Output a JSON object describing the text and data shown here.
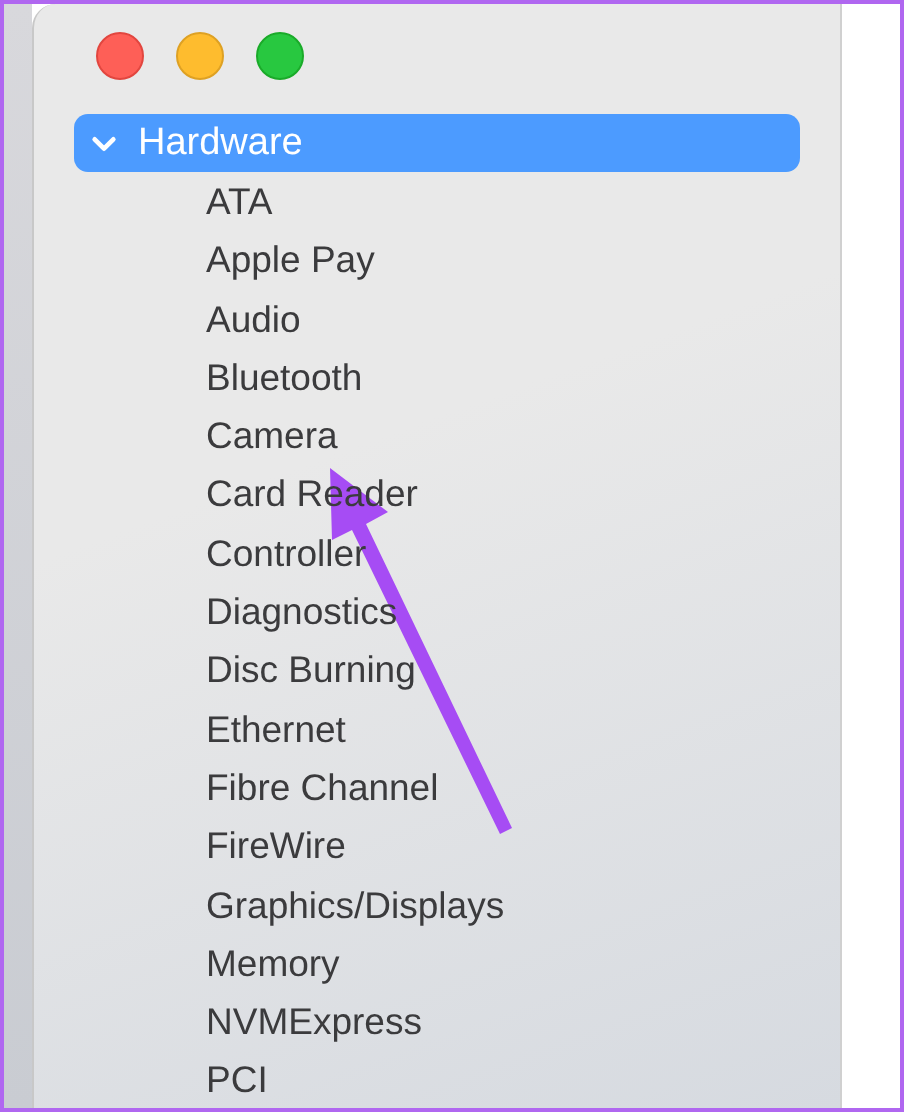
{
  "sidebar": {
    "groups": [
      {
        "label": "Hardware",
        "selected": true,
        "expanded": true,
        "children": [
          {
            "label": "ATA"
          },
          {
            "label": "Apple Pay"
          },
          {
            "label": "Audio"
          },
          {
            "label": "Bluetooth"
          },
          {
            "label": "Camera"
          },
          {
            "label": "Card Reader"
          },
          {
            "label": "Controller"
          },
          {
            "label": "Diagnostics"
          },
          {
            "label": "Disc Burning"
          },
          {
            "label": "Ethernet"
          },
          {
            "label": "Fibre Channel"
          },
          {
            "label": "FireWire"
          },
          {
            "label": "Graphics/Displays"
          },
          {
            "label": "Memory"
          },
          {
            "label": "NVMExpress"
          },
          {
            "label": "PCI"
          }
        ]
      }
    ]
  }
}
